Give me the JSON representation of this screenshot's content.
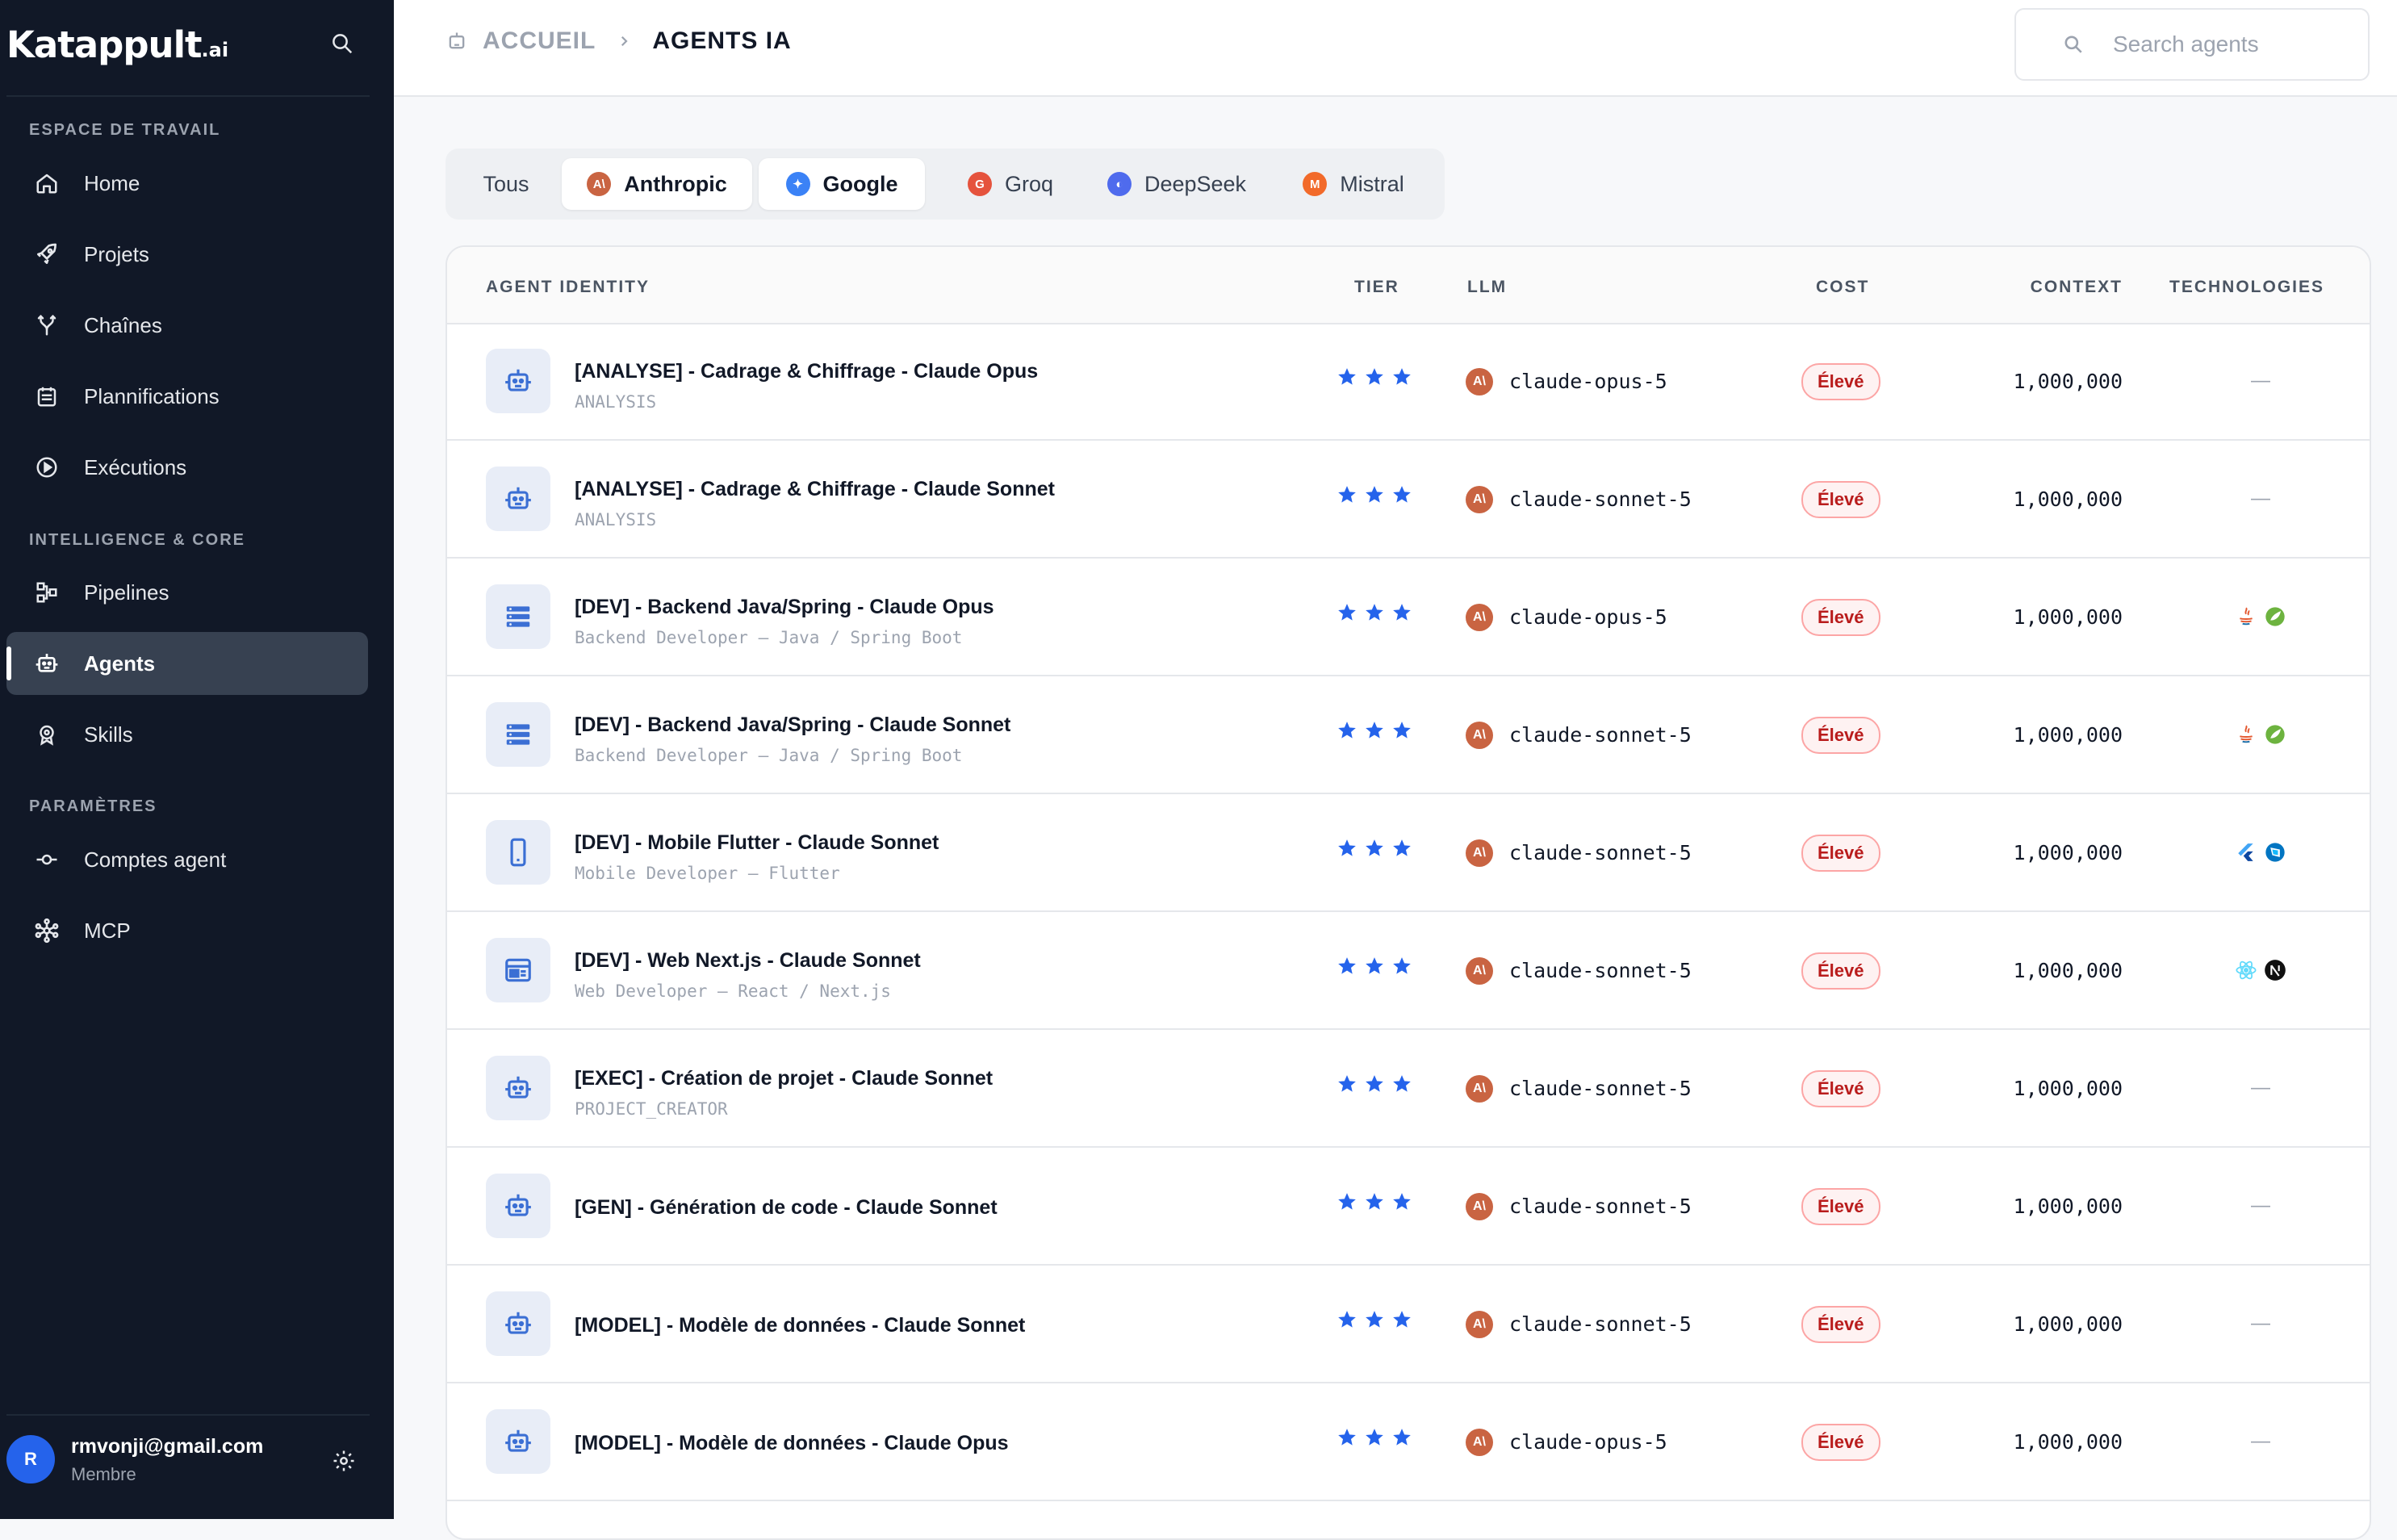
{
  "app": {
    "brand_main": "Katappult",
    "brand_suffix": ".ai"
  },
  "sidebar": {
    "sections": [
      {
        "label": "ESPACE DE TRAVAIL"
      },
      {
        "label": "INTELLIGENCE & CORE"
      },
      {
        "label": "PARAMÈTRES"
      }
    ],
    "items": [
      {
        "label": "Home",
        "icon": "home-icon"
      },
      {
        "label": "Projets",
        "icon": "rocket-icon"
      },
      {
        "label": "Chaînes",
        "icon": "branch-icon"
      },
      {
        "label": "Plannifications",
        "icon": "calendar-icon"
      },
      {
        "label": "Exécutions",
        "icon": "play-circle-icon"
      },
      {
        "label": "Pipelines",
        "icon": "pipeline-icon"
      },
      {
        "label": "Agents",
        "icon": "robot-icon",
        "active": true
      },
      {
        "label": "Skills",
        "icon": "badge-icon"
      },
      {
        "label": "Comptes agent",
        "icon": "commit-icon"
      },
      {
        "label": "MCP",
        "icon": "network-icon"
      }
    ],
    "user": {
      "initial": "R",
      "email": "rmvonji@gmail.com",
      "role": "Membre"
    }
  },
  "header": {
    "breadcrumb_home": "ACCUEIL",
    "breadcrumb_current": "AGENTS IA",
    "search_placeholder": "Search agents"
  },
  "tabs": [
    {
      "label": "Tous"
    },
    {
      "label": "Anthropic",
      "badge": "A\\",
      "color": "#c96442",
      "selected": true
    },
    {
      "label": "Google",
      "badge": "✦",
      "color": "#3b82f6",
      "selected": true
    },
    {
      "label": "Groq",
      "badge": "G",
      "color": "#e5533d"
    },
    {
      "label": "DeepSeek",
      "badge": "◐",
      "color": "#4f6bed"
    },
    {
      "label": "Mistral",
      "badge": "M",
      "color": "#f26a2a"
    }
  ],
  "table": {
    "headers": {
      "identity": "AGENT IDENTITY",
      "tier": "TIER",
      "llm": "LLM",
      "cost": "COST",
      "context": "CONTEXT",
      "technologies": "TECHNOLOGIES"
    },
    "rows": [
      {
        "name": "[ANALYSE] - Cadrage & Chiffrage - Claude Opus",
        "subtitle": "ANALYSIS",
        "icon": "robot-icon",
        "tier": 3,
        "llm": "claude-opus-5",
        "cost": "Élevé",
        "context": "1,000,000",
        "tech": "—",
        "tech_icons": []
      },
      {
        "name": "[ANALYSE] - Cadrage & Chiffrage - Claude Sonnet",
        "subtitle": "ANALYSIS",
        "icon": "robot-icon",
        "tier": 3,
        "llm": "claude-sonnet-5",
        "cost": "Élevé",
        "context": "1,000,000",
        "tech": "—",
        "tech_icons": []
      },
      {
        "name": "[DEV] - Backend Java/Spring - Claude Opus",
        "subtitle": "Backend Developer — Java / Spring Boot",
        "icon": "server-icon",
        "tier": 3,
        "llm": "claude-opus-5",
        "cost": "Élevé",
        "context": "1,000,000",
        "tech": "",
        "tech_icons": [
          "java-icon",
          "spring-icon"
        ]
      },
      {
        "name": "[DEV] - Backend Java/Spring - Claude Sonnet",
        "subtitle": "Backend Developer — Java / Spring Boot",
        "icon": "server-icon",
        "tier": 3,
        "llm": "claude-sonnet-5",
        "cost": "Élevé",
        "context": "1,000,000",
        "tech": "",
        "tech_icons": [
          "java-icon",
          "spring-icon"
        ]
      },
      {
        "name": "[DEV] - Mobile Flutter - Claude Sonnet",
        "subtitle": "Mobile Developer — Flutter",
        "icon": "phone-icon",
        "tier": 3,
        "llm": "claude-sonnet-5",
        "cost": "Élevé",
        "context": "1,000,000",
        "tech": "",
        "tech_icons": [
          "flutter-icon",
          "dart-icon"
        ]
      },
      {
        "name": "[DEV] - Web Next.js - Claude Sonnet",
        "subtitle": "Web Developer — React / Next.js",
        "icon": "browser-icon",
        "tier": 3,
        "llm": "claude-sonnet-5",
        "cost": "Élevé",
        "context": "1,000,000",
        "tech": "",
        "tech_icons": [
          "react-icon",
          "nextjs-icon"
        ]
      },
      {
        "name": "[EXEC] - Création de projet - Claude Sonnet",
        "subtitle": "PROJECT_CREATOR",
        "icon": "robot-icon",
        "tier": 3,
        "llm": "claude-sonnet-5",
        "cost": "Élevé",
        "context": "1,000,000",
        "tech": "—",
        "tech_icons": []
      },
      {
        "name": "[GEN] - Génération de code - Claude Sonnet",
        "subtitle": "",
        "icon": "robot-icon",
        "tier": 3,
        "llm": "claude-sonnet-5",
        "cost": "Élevé",
        "context": "1,000,000",
        "tech": "—",
        "tech_icons": []
      },
      {
        "name": "[MODEL] - Modèle de données - Claude Sonnet",
        "subtitle": "",
        "icon": "robot-icon",
        "tier": 3,
        "llm": "claude-sonnet-5",
        "cost": "Élevé",
        "context": "1,000,000",
        "tech": "—",
        "tech_icons": []
      },
      {
        "name": "[MODEL] - Modèle de données - Claude Opus",
        "subtitle": "",
        "icon": "robot-icon",
        "tier": 3,
        "llm": "claude-opus-5",
        "cost": "Élevé",
        "context": "1,000,000",
        "tech": "—",
        "tech_icons": []
      }
    ]
  },
  "colors": {
    "sidebar_bg": "#111827",
    "accent_blue": "#2563eb",
    "anthropic": "#c96442",
    "cost_red": "#b91c1c"
  }
}
